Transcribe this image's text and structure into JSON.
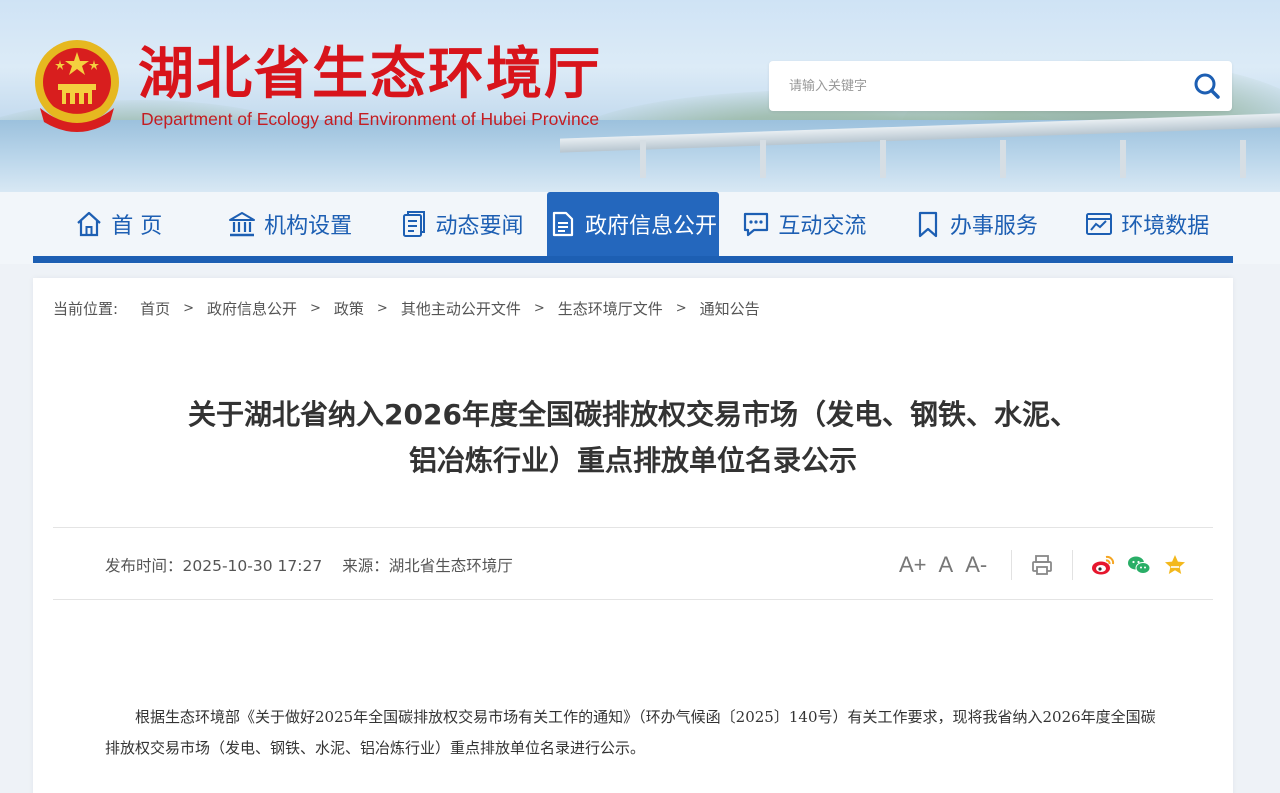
{
  "header": {
    "title_cn": "湖北省生态环境厅",
    "title_en": "Department of Ecology and Environment of Hubei Province"
  },
  "search": {
    "placeholder": "请输入关键字"
  },
  "nav": {
    "items": [
      {
        "label": "首 页",
        "icon": "home-icon"
      },
      {
        "label": "机构设置",
        "icon": "building-icon"
      },
      {
        "label": "动态要闻",
        "icon": "document-icon"
      },
      {
        "label": "政府信息公开",
        "icon": "file-text-icon",
        "active": true
      },
      {
        "label": "互动交流",
        "icon": "chat-icon"
      },
      {
        "label": "办事服务",
        "icon": "bookmark-icon"
      },
      {
        "label": "环境数据",
        "icon": "chart-icon"
      }
    ]
  },
  "breadcrumb": {
    "label": "当前位置:",
    "items": [
      "首页",
      "政府信息公开",
      "政策",
      "其他主动公开文件",
      "生态环境厅文件",
      "通知公告"
    ]
  },
  "article": {
    "title_line1": "关于湖北省纳入2026年度全国碳排放权交易市场（发电、钢铁、水泥、",
    "title_line2": "铝冶炼行业）重点排放单位名录公示",
    "publish_label": "发布时间：2025-10-30 17:27",
    "source_label": "来源：湖北省生态环境厅",
    "body": "根据生态环境部《关于做好2025年全国碳排放权交易市场有关工作的通知》（环办气候函〔2025〕140号）有关工作要求，现将我省纳入2026年度全国碳排放权交易市场（发电、钢铁、水泥、铝冶炼行业）重点排放单位名录进行公示。"
  },
  "tools": {
    "font_increase": "A+",
    "font_normal": "A",
    "font_decrease": "A-"
  },
  "colors": {
    "brand_red": "#d8141b",
    "nav_blue": "#1d5fb3",
    "nav_active": "#2467bd"
  }
}
